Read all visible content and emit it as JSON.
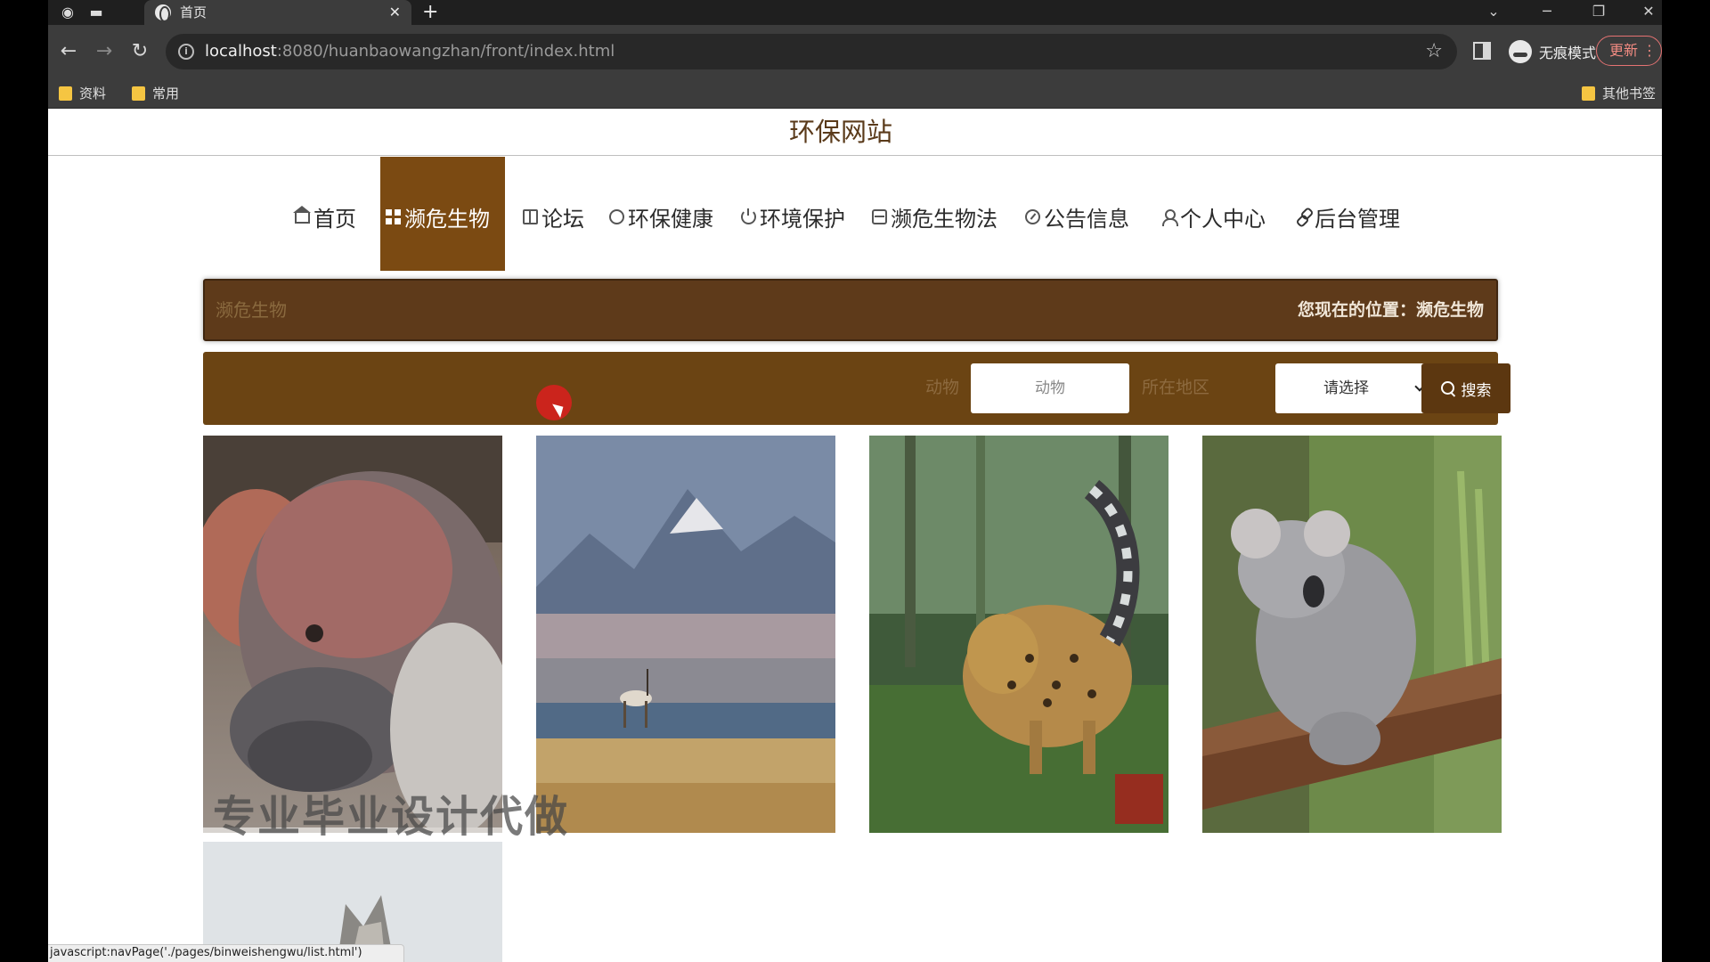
{
  "browser": {
    "tab_title": "首页",
    "url_host": "localhost",
    "url_rest": ":8080/huanbaowangzhan/front/index.html",
    "incognito_label": "无痕模式",
    "update_label": "更新",
    "bookmarks": [
      "资料",
      "常用"
    ],
    "other_bookmarks": "其他书签",
    "status_text": "javascript:navPage('./pages/binweishengwu/list.html')"
  },
  "site": {
    "title": "环保网站"
  },
  "nav": {
    "items": [
      {
        "label": "首页",
        "icon": "home-icon"
      },
      {
        "label": "濒危生物",
        "icon": "grid-icon",
        "active": true
      },
      {
        "label": "论坛",
        "icon": "book-icon"
      },
      {
        "label": "环保健康",
        "icon": "circle-icon"
      },
      {
        "label": "环境保护",
        "icon": "power-icon"
      },
      {
        "label": "濒危生物法",
        "icon": "print-icon"
      },
      {
        "label": "公告信息",
        "icon": "gauge-icon"
      },
      {
        "label": "个人中心",
        "icon": "user-icon"
      },
      {
        "label": "后台管理",
        "icon": "link-icon"
      }
    ]
  },
  "breadcrumb": {
    "title": "濒危生物",
    "location_prefix": "您现在的位置：",
    "location": "濒危生物",
    "full": "您现在的位置：濒危生物"
  },
  "search": {
    "animal_label": "动物",
    "animal_placeholder": "动物",
    "region_label": "所在地区",
    "region_selected": "请选择",
    "button_label": "搜索"
  },
  "overlay": {
    "watermark": "专业毕业设计代做"
  },
  "colors": {
    "nav_active": "#7b4a12",
    "crumb_bg": "#5e3a1a",
    "search_bg": "#6b4413",
    "button_bg": "#5c3710"
  }
}
